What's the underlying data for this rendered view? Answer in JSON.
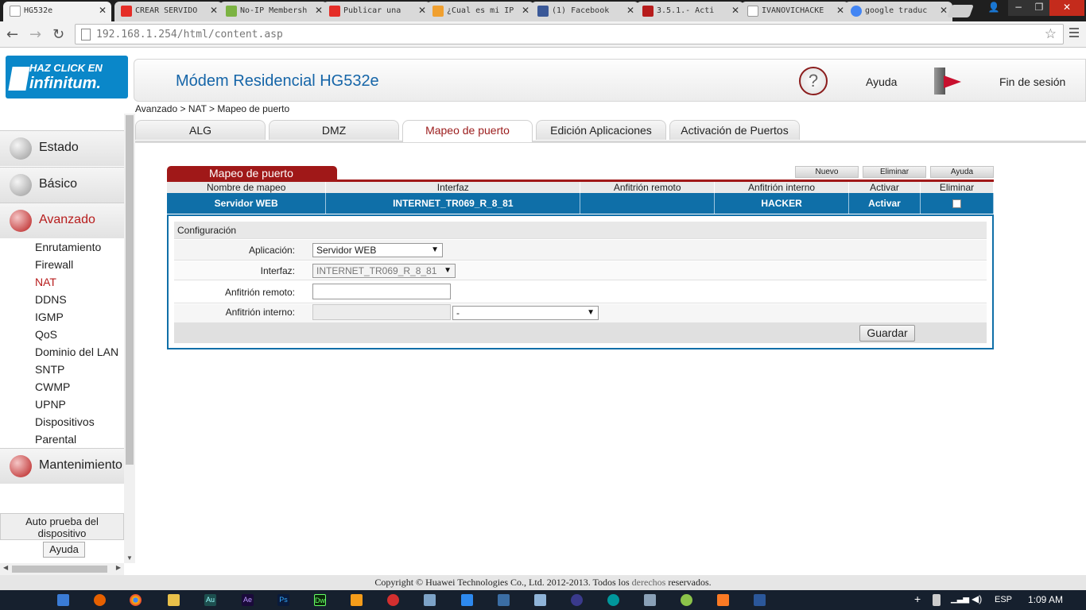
{
  "browser": {
    "tabs": [
      {
        "label": "HG532e",
        "active": true,
        "icon_color": "#ffffff",
        "icon": "page-icon"
      },
      {
        "label": "CREAR SERVIDO",
        "icon_color": "#e52d27",
        "icon": "youtube-icon"
      },
      {
        "label": "No-IP Membersh",
        "icon_color": "#7cb342",
        "icon": "noip-icon"
      },
      {
        "label": "Publicar una",
        "icon_color": "#e52d27",
        "icon": "youtube-icon"
      },
      {
        "label": "¿Cual es mi IP",
        "icon_color": "#f0a030",
        "icon": "ip-icon"
      },
      {
        "label": "(1) Facebook",
        "icon_color": "#3b5998",
        "icon": "facebook-icon"
      },
      {
        "label": "3.5.1.- Acti",
        "icon_color": "#b71c1c",
        "icon": "site-icon"
      },
      {
        "label": "IVANOVICHACKE",
        "icon_color": "#ffffff",
        "icon": "page-icon"
      },
      {
        "label": "google traduc",
        "icon_color": "#4285f4",
        "icon": "google-icon"
      }
    ],
    "url": "192.168.1.254/html/content.asp",
    "window_controls": {
      "user": "👤",
      "minimize": "−",
      "restore": "❐",
      "close": "✕"
    }
  },
  "header": {
    "logo_line1": "HAZ CLICK EN",
    "logo_line2": "infinitum.",
    "title": "Módem Residencial HG532e",
    "help": "Ayuda",
    "logout": "Fin de sesión"
  },
  "sidebar": {
    "main": [
      {
        "label": "Estado",
        "active": false
      },
      {
        "label": "Básico",
        "active": false
      },
      {
        "label": "Avanzado",
        "active": true
      },
      {
        "label": "Mantenimiento",
        "active": false
      }
    ],
    "sub": [
      "Enrutamiento",
      "Firewall",
      "NAT",
      "DDNS",
      "IGMP",
      "QoS",
      "Dominio del LAN",
      "SNTP",
      "CWMP",
      "UPNP",
      "Dispositivos",
      "Parental"
    ],
    "active_sub": "NAT",
    "self_test": "Auto prueba del dispositivo",
    "help_button": "Ayuda"
  },
  "breadcrumb": "Avanzado > NAT > Mapeo de puerto",
  "page_tabs": [
    "ALG",
    "DMZ",
    "Mapeo de puerto",
    "Edición Aplicaciones",
    "Activación de Puertos"
  ],
  "panel": {
    "title": "Mapeo de puerto",
    "buttons": {
      "new": "Nuevo",
      "delete": "Eliminar",
      "help": "Ayuda"
    },
    "columns": [
      "Nombre de mapeo",
      "Interfaz",
      "Anfitrión remoto",
      "Anfitrión interno",
      "Activar",
      "Eliminar"
    ],
    "row": {
      "name": "Servidor WEB",
      "interface": "INTERNET_TR069_R_8_81",
      "remote": "",
      "internal": "HACKER",
      "enable": "Activar"
    }
  },
  "config": {
    "heading": "Configuración",
    "app_label": "Aplicación:",
    "app_value": "Servidor WEB",
    "iface_label": "Interfaz:",
    "iface_value": "INTERNET_TR069_R_8_81",
    "remote_label": "Anfitrión remoto:",
    "remote_value": "",
    "internal_label": "Anfitrión interno:",
    "internal_value": "",
    "internal_select": "-",
    "save": "Guardar"
  },
  "footer": {
    "prefix": "Copyright © Huawei Technologies Co., Ltd. 2012-2013. Todos los",
    "link": "derechos",
    "suffix": "reservados."
  },
  "taskbar": {
    "apps": [
      "windows-explorer",
      "firefox",
      "chrome",
      "file-explorer",
      "audition",
      "after-effects",
      "photoshop",
      "dreamweaver",
      "fl-studio",
      "media-app",
      "virtualbox",
      "store",
      "xampp-panel",
      "cube-app",
      "eclipse",
      "arduino",
      "settings",
      "sync-app",
      "xampp",
      "word"
    ],
    "app_labels": {
      "audition": "Au",
      "after-effects": "Ae",
      "photoshop": "Ps",
      "dreamweaver": "Dw"
    },
    "language": "ESP",
    "time": "1:09 AM"
  },
  "colors": {
    "accent_red": "#a01818",
    "table_blue": "#0f6fa8",
    "title_blue": "#1565a8"
  }
}
